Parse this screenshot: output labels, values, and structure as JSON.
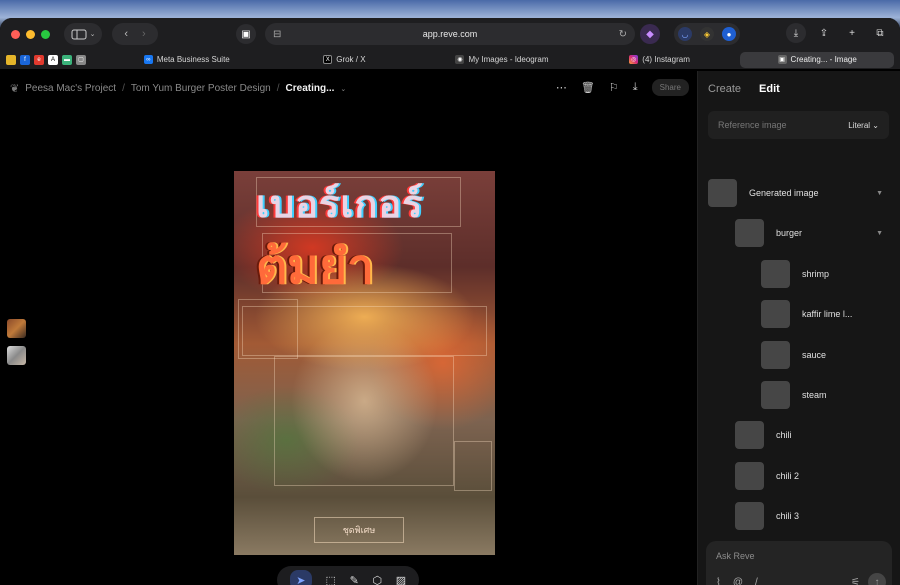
{
  "browser": {
    "url": "app.reve.com",
    "tabs": [
      {
        "label": "Meta Business Suite",
        "icon": "meta-icon",
        "active": false
      },
      {
        "label": "Grok / X",
        "icon": "x-icon",
        "active": false
      },
      {
        "label": "My Images - Ideogram",
        "icon": "ideogram-icon",
        "active": false
      },
      {
        "label": "(4) Instagram",
        "icon": "instagram-icon",
        "active": false
      },
      {
        "label": "Creating... - Image",
        "icon": "reve-icon",
        "active": true
      }
    ]
  },
  "header": {
    "breadcrumb": [
      "Peesa Mac's Project",
      "Tom Yum Burger Poster Design",
      "Creating..."
    ],
    "share_label": "Share"
  },
  "poster": {
    "title_line1": "เบอร์เกอร์",
    "title_line2": "ต้มยำ",
    "footer_text": "ชุดพิเศษ"
  },
  "sidebar": {
    "tabs": [
      "Create",
      "Edit"
    ],
    "active_tab": "Edit",
    "reference_placeholder": "Reference image",
    "reference_mode": "Literal",
    "tree": [
      {
        "label": "Generated image",
        "level": 0,
        "expanded": true
      },
      {
        "label": "burger",
        "level": 1,
        "expanded": true
      },
      {
        "label": "shrimp",
        "level": 2
      },
      {
        "label": "kaffir lime l...",
        "level": 2
      },
      {
        "label": "sauce",
        "level": 2
      },
      {
        "label": "steam",
        "level": 2
      },
      {
        "label": "chili",
        "level": 1
      },
      {
        "label": "chili 2",
        "level": 1
      },
      {
        "label": "chili 3",
        "level": 1
      }
    ],
    "ask_placeholder": "Ask Reve",
    "ask_icons": [
      "paperclip-icon",
      "at-icon",
      "slash-icon"
    ]
  },
  "colors": {
    "accent": "#7ea3ff",
    "sidebar_bg": "#161616",
    "canvas_bg": "#000000"
  }
}
